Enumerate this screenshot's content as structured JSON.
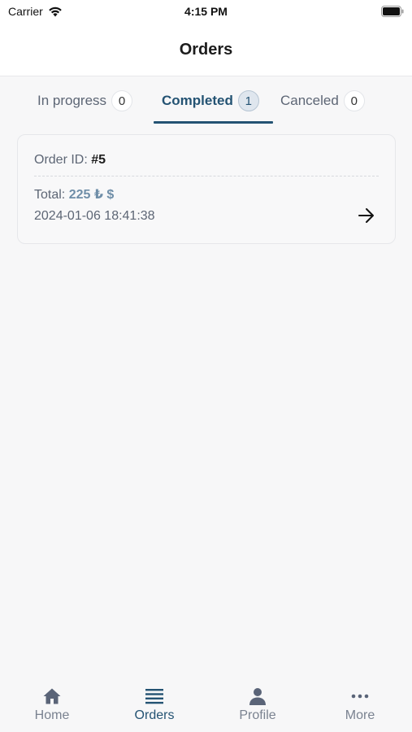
{
  "status_bar": {
    "carrier": "Carrier",
    "time": "4:15 PM"
  },
  "header": {
    "title": "Orders"
  },
  "tabs": [
    {
      "label": "In progress",
      "count": "0",
      "active": false
    },
    {
      "label": "Completed",
      "count": "1",
      "active": true
    },
    {
      "label": "Canceled",
      "count": "0",
      "active": false
    }
  ],
  "orders": [
    {
      "id_label": "Order ID:",
      "id_value": "#5",
      "total_label": "Total:",
      "total_value": "225 ₺ $",
      "date": "2024-01-06 18:41:38"
    }
  ],
  "bottom_nav": [
    {
      "label": "Home",
      "icon": "home-icon",
      "active": false
    },
    {
      "label": "Orders",
      "icon": "list-icon",
      "active": true
    },
    {
      "label": "Profile",
      "icon": "person-icon",
      "active": false
    },
    {
      "label": "More",
      "icon": "more-dots-icon",
      "active": false
    }
  ],
  "colors": {
    "accent": "#245373",
    "total_value": "#6f8ea8",
    "inactive": "#7a8290"
  }
}
